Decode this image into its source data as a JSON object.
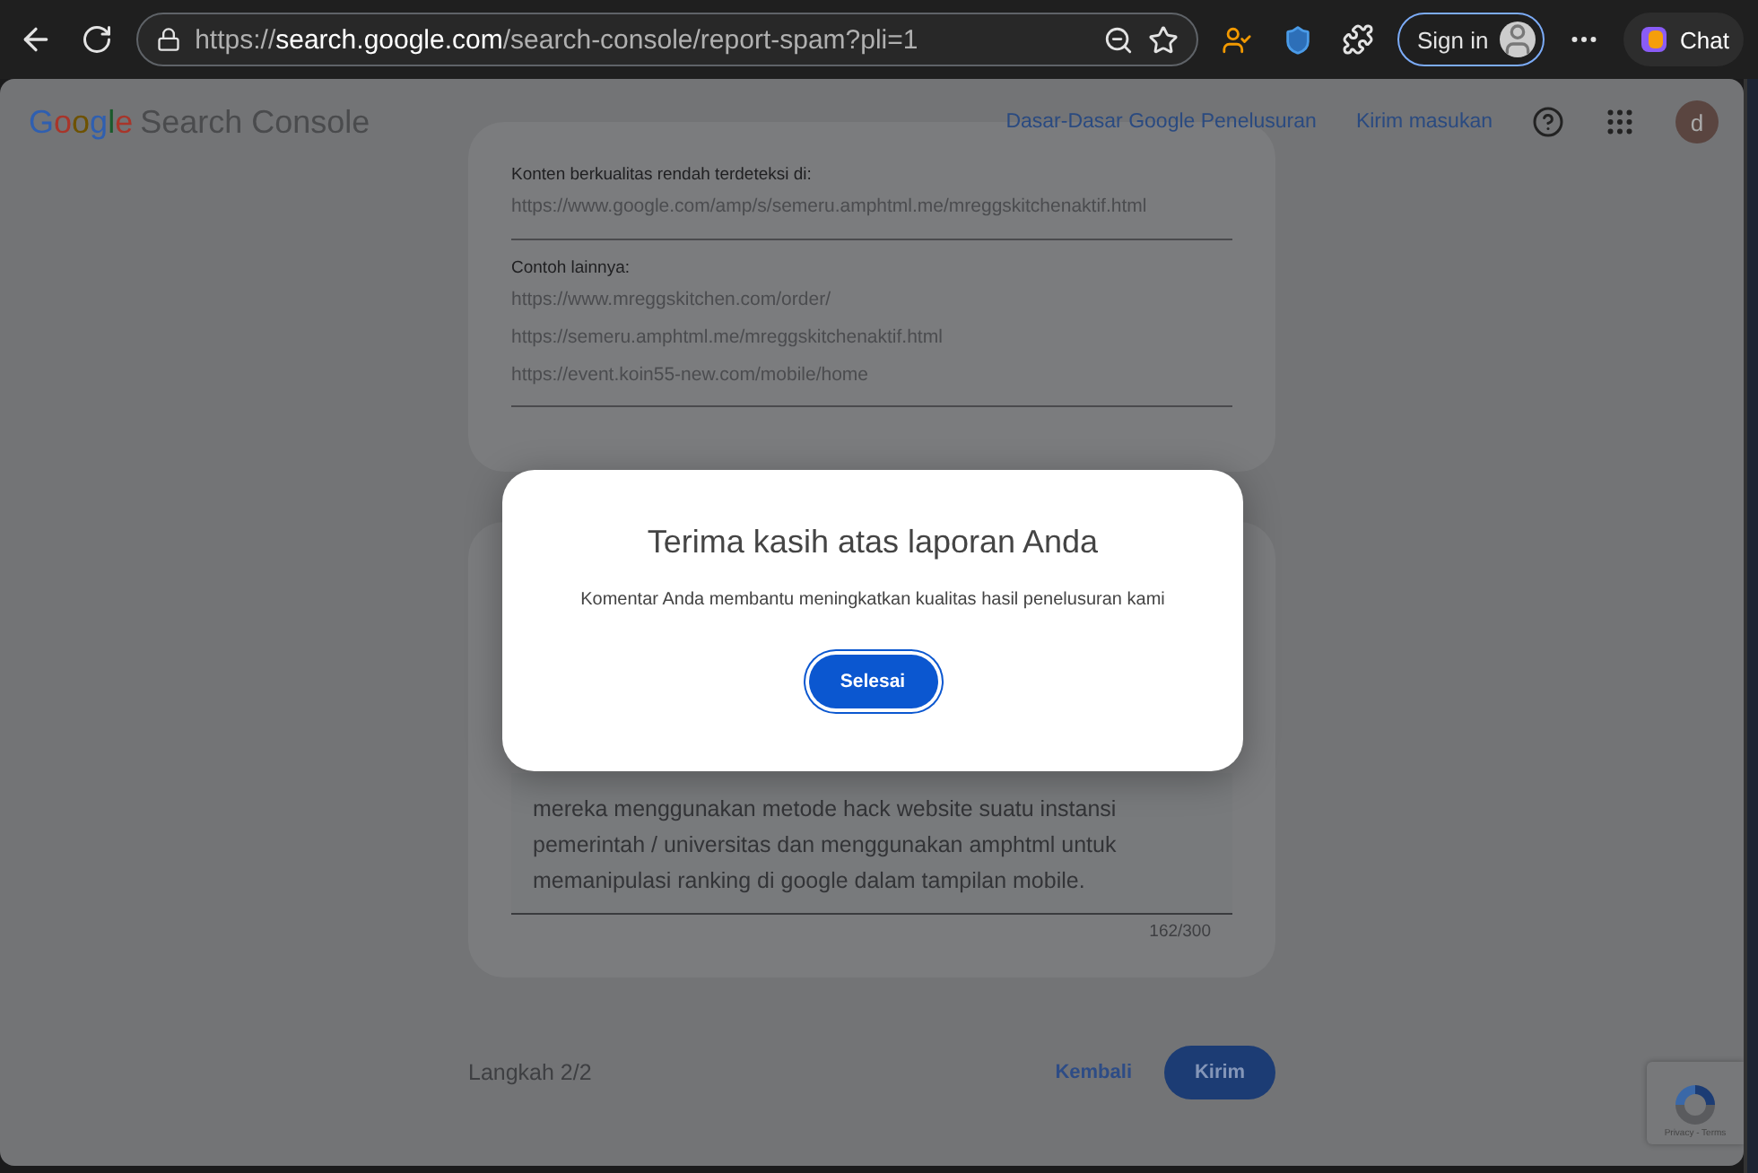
{
  "browser": {
    "url_scheme": "https://",
    "url_host": "search.google.com",
    "url_path": "/search-console/report-spam?pli=1",
    "sign_in": "Sign in",
    "chat": "Chat"
  },
  "header": {
    "logo": "Google",
    "product": "Search Console",
    "links": [
      "Dasar-Dasar Google Penelusuran",
      "Kirim masukan"
    ],
    "avatar": "d"
  },
  "detected": {
    "label": "Konten berkualitas rendah terdeteksi di:",
    "url": "https://www.google.com/amp/s/semeru.amphtml.me/mreggskitchenaktif.html"
  },
  "examples": {
    "label": "Contoh lainnya:",
    "urls": [
      "https://www.mreggskitchen.com/order/",
      "https://semeru.amphtml.me/mreggskitchenaktif.html",
      "https://event.koin55-new.com/mobile/home"
    ]
  },
  "comment": {
    "value": "mereka menggunakan metode hack website suatu instansi pemerintah / universitas dan menggunakan amphtml untuk memanipulasi ranking di google dalam tampilan mobile.",
    "counter": "162/300"
  },
  "footer": {
    "step": "Langkah 2/2",
    "back": "Kembali",
    "submit": "Kirim"
  },
  "dialog": {
    "title": "Terima kasih atas laporan Anda",
    "message": "Komentar Anda membantu meningkatkan kualitas hasil penelusuran kami",
    "button": "Selesai"
  },
  "recaptcha": {
    "links": "Privacy - Terms"
  }
}
